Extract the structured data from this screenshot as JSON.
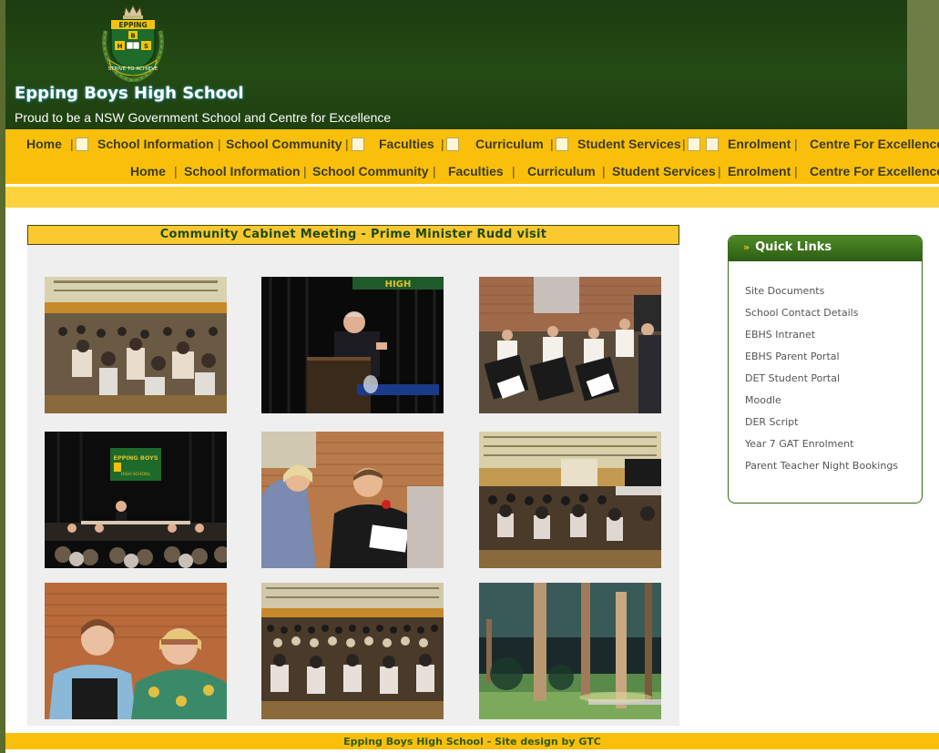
{
  "header": {
    "crest_text_top": "EPPING",
    "crest_letters": [
      "B",
      "H",
      "S"
    ],
    "crest_motto": "STRIVE TO ACHIEVE",
    "school_name": "Epping Boys High School",
    "tagline": "Proud to be a NSW Government School and Centre for Excellence"
  },
  "nav_primary": [
    {
      "label": "Home"
    },
    {
      "label": "School Information"
    },
    {
      "label": "School Community"
    },
    {
      "label": "Faculties"
    },
    {
      "label": "Curriculum"
    },
    {
      "label": "Student Services"
    },
    {
      "label": "Enrolment"
    },
    {
      "label": "Centre For Excellence"
    }
  ],
  "nav_secondary": [
    {
      "label": "Home"
    },
    {
      "label": "School Information"
    },
    {
      "label": "School Community"
    },
    {
      "label": "Faculties"
    },
    {
      "label": "Curriculum"
    },
    {
      "label": "Student Services"
    },
    {
      "label": "Enrolment"
    },
    {
      "label": "Centre For Excellence"
    }
  ],
  "gallery": {
    "title": "Community Cabinet Meeting - Prime Minister Rudd visit",
    "banner_text_photo2": "HIGH",
    "banner_text_photo4": [
      "EPPING BOYS",
      "HIGH SCHOOL"
    ]
  },
  "quick_links": {
    "title": "Quick Links",
    "chevron": "»",
    "items": [
      "Site Documents",
      "School Contact Details",
      "EBHS Intranet",
      "EBHS Parent Portal",
      "DET Student Portal",
      "Moodle",
      "DER Script",
      "Year 7 GAT Enrolment",
      "Parent Teacher Night Bookings"
    ]
  },
  "footer": {
    "text": "Epping Boys High School - Site design by GTC"
  },
  "colors": {
    "header_green": "#244a14",
    "nav_yellow": "#f9bf0a",
    "title_yellow": "#fcc830",
    "link_green": "#2d5c12"
  }
}
